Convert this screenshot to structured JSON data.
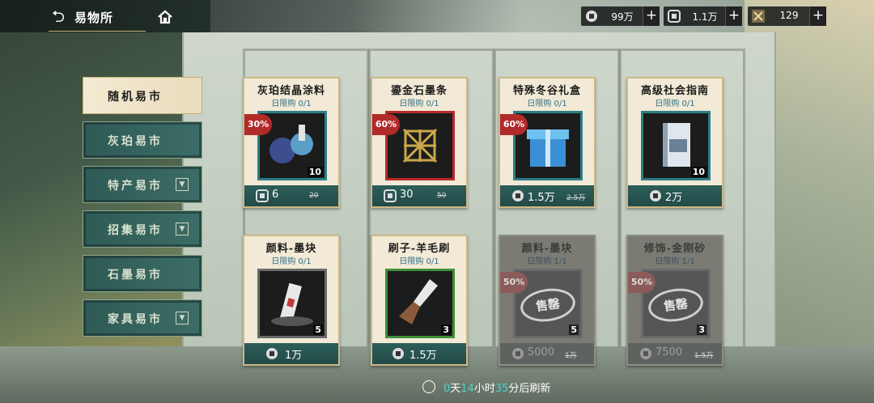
{
  "header": {
    "title": "易物所",
    "resources": [
      {
        "icon": "silver-coin-icon",
        "value": "99万"
      },
      {
        "icon": "ticket-icon",
        "value": "1.1万"
      },
      {
        "icon": "token-icon",
        "value": "129"
      }
    ],
    "plus": "+"
  },
  "sidebar": {
    "items": [
      {
        "label": "随机易市",
        "active": true,
        "dropdown": false
      },
      {
        "label": "灰珀易市",
        "active": false,
        "dropdown": false
      },
      {
        "label": "特产易市",
        "active": false,
        "dropdown": true
      },
      {
        "label": "招集易市",
        "active": false,
        "dropdown": true
      },
      {
        "label": "石墨易市",
        "active": false,
        "dropdown": false
      },
      {
        "label": "家具易市",
        "active": false,
        "dropdown": true
      }
    ]
  },
  "shop": {
    "items": [
      {
        "name": "灰珀结晶涂料",
        "limit": "日限购 0/1",
        "discount": "30%",
        "qty": "10",
        "currency": "ticket",
        "price": "6",
        "old_price": "20",
        "sold_out": false,
        "frame": "teal"
      },
      {
        "name": "鎏金石墨条",
        "limit": "日限购 0/1",
        "discount": "60%",
        "qty": "",
        "currency": "ticket",
        "price": "30",
        "old_price": "50",
        "sold_out": false,
        "frame": "red"
      },
      {
        "name": "特殊冬谷礼盒",
        "limit": "日限购 0/1",
        "discount": "60%",
        "qty": "",
        "currency": "coin",
        "price": "1.5万",
        "old_price": "2.5万",
        "sold_out": false,
        "frame": "teal"
      },
      {
        "name": "高级社会指南",
        "limit": "日限购 0/1",
        "discount": "",
        "qty": "10",
        "currency": "coin",
        "price": "2万",
        "old_price": "",
        "sold_out": false,
        "frame": "teal"
      },
      {
        "name": "颜料-墨块",
        "limit": "日限购 0/1",
        "discount": "",
        "qty": "5",
        "currency": "coin",
        "price": "1万",
        "old_price": "",
        "sold_out": false,
        "frame": "grey"
      },
      {
        "name": "刷子-羊毛刷",
        "limit": "日限购 0/1",
        "discount": "",
        "qty": "3",
        "currency": "coin",
        "price": "1.5万",
        "old_price": "",
        "sold_out": false,
        "frame": "green"
      },
      {
        "name": "颜料-墨块",
        "limit": "日限购 1/1",
        "discount": "50%",
        "qty": "5",
        "currency": "coin",
        "price": "5000",
        "old_price": "1万",
        "sold_out": true,
        "frame": "grey"
      },
      {
        "name": "修饰-金刚砂",
        "limit": "日限购 1/1",
        "discount": "50%",
        "qty": "3",
        "currency": "coin",
        "price": "7500",
        "old_price": "1.5万",
        "sold_out": true,
        "frame": "grey"
      }
    ],
    "sold_stamp": "售罄"
  },
  "refresh": {
    "days": "0",
    "days_unit": "天",
    "hours": "14",
    "hours_unit": "小时",
    "minutes": "35",
    "suffix": "分后刷新"
  },
  "colors": {
    "accent_teal": "#2c7f86",
    "discount_red": "#b22a2a",
    "refresh_highlight": "#4fd3c5"
  }
}
